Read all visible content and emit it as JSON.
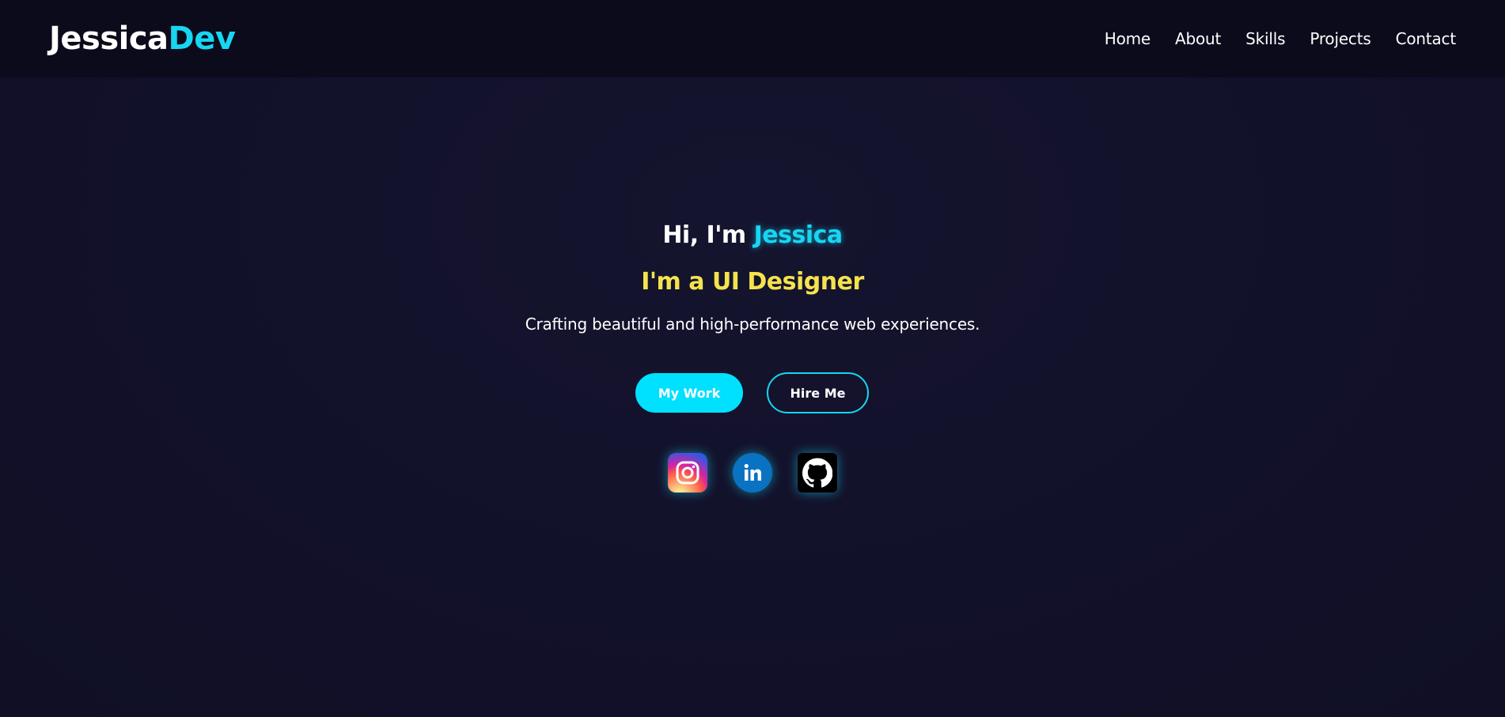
{
  "header": {
    "logo_main": "Jessica",
    "logo_accent": "Dev",
    "nav": [
      {
        "label": "Home"
      },
      {
        "label": "About"
      },
      {
        "label": "Skills"
      },
      {
        "label": "Projects"
      },
      {
        "label": "Contact"
      }
    ]
  },
  "hero": {
    "greeting_prefix": "Hi, I'm ",
    "greeting_name": "Jessica",
    "role": "I'm a UI Designer",
    "tagline": "Crafting beautiful and high-performance web experiences.",
    "primary_button": "My Work",
    "secondary_button": "Hire Me",
    "socials": [
      {
        "icon": "instagram-icon"
      },
      {
        "icon": "linkedin-icon"
      },
      {
        "icon": "github-icon"
      }
    ]
  },
  "colors": {
    "background": "#13122a",
    "header_background": "#0c0b1c",
    "accent_cyan": "#17d6f2",
    "accent_yellow": "#f4e34d",
    "text": "#ffffff"
  }
}
